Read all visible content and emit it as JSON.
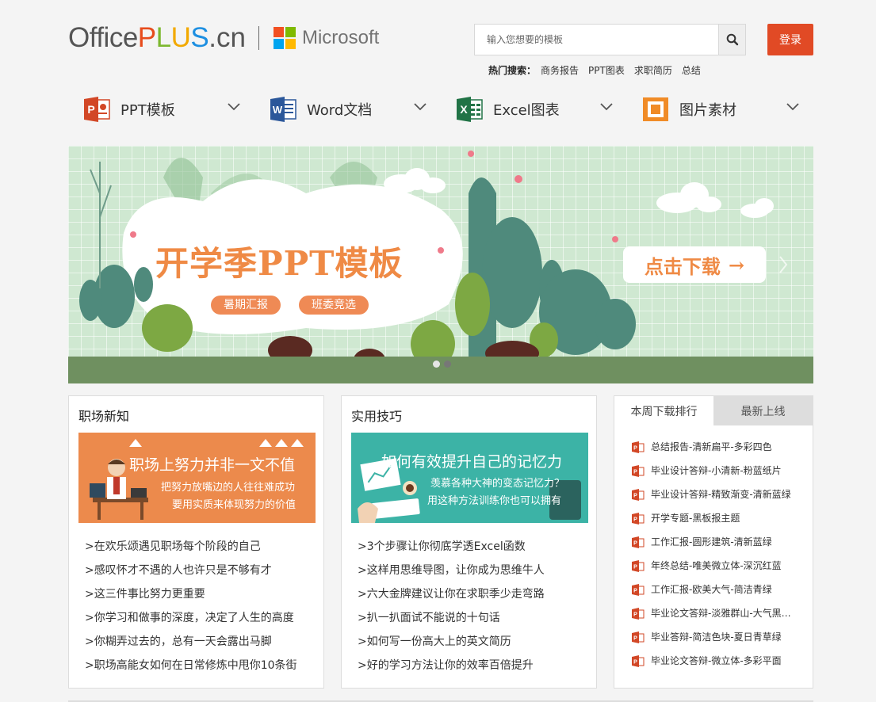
{
  "header": {
    "logo": {
      "office": "Office",
      "plus": [
        "P",
        "L",
        "U",
        "S"
      ],
      "cn": ".cn",
      "microsoft": "Microsoft"
    },
    "search": {
      "placeholder": "输入您想要的模板"
    },
    "login_label": "登录",
    "hot_search": {
      "label": "热门搜索：",
      "terms": [
        "商务报告",
        "PPT图表",
        "求职简历",
        "总结"
      ]
    }
  },
  "nav": {
    "items": [
      {
        "label": "PPT模板",
        "icon": "powerpoint-icon",
        "color": "#d24726"
      },
      {
        "label": "Word文档",
        "icon": "word-icon",
        "color": "#2b579a"
      },
      {
        "label": "Excel图表",
        "icon": "excel-icon",
        "color": "#217346"
      },
      {
        "label": "图片素材",
        "icon": "picture-icon",
        "color": "#f08b27"
      }
    ]
  },
  "banner": {
    "title": "开学季PPT模板",
    "tags": [
      "暑期汇报",
      "班委竞选"
    ],
    "cta": "点击下载",
    "cta_arrow": "→",
    "slide_count": 2,
    "active_slide": 1
  },
  "panels": [
    {
      "title": "职场新知",
      "image": {
        "headline": "职场上努力并非一文不值",
        "line1": "把努力放嘴边的人往往难成功",
        "line2": "要用实质来体现努力的价值",
        "bg": "#ec8a4c"
      },
      "items": [
        ">在欢乐颂遇见职场每个阶段的自己",
        ">感叹怀才不遇的人也许只是不够有才",
        ">这三件事比努力更重要",
        ">你学习和做事的深度，决定了人生的高度",
        ">你糊弄过去的，总有一天会露出马脚",
        ">职场高能女如何在日常修炼中甩你10条街"
      ]
    },
    {
      "title": "实用技巧",
      "image": {
        "headline": "如何有效提升自己的记忆力",
        "line1": "羡慕各种大神的变态记忆力？",
        "line2": "用这种方法训练你也可以拥有",
        "bg": "#3cb3a6"
      },
      "items": [
        ">3个步骤让你彻底学透Excel函数",
        ">这样用思维导图，让你成为思维牛人",
        ">六大金牌建议让你在求职季少走弯路",
        ">扒一扒面试不能说的十句话",
        ">如何写一份高大上的英文简历",
        ">好的学习方法让你的效率百倍提升"
      ]
    }
  ],
  "ranking": {
    "tabs": [
      "本周下载排行",
      "最新上线"
    ],
    "items": [
      "总结报告-清新扁平-多彩四色",
      "毕业设计答辩-小清新-粉蓝纸片",
      "毕业设计答辩-精致渐变-清新蓝绿",
      "开学专题-黑板报主题",
      "工作汇报-圆形建筑-清新蓝绿",
      "年终总结-唯美微立体-深沉红蓝",
      "工作汇报-欧美大气-简洁青绿",
      "毕业论文答辩-淡雅群山-大气黑…",
      "毕业答辩-简洁色块-夏日青草绿",
      "毕业论文答辩-微立体-多彩平面"
    ]
  }
}
